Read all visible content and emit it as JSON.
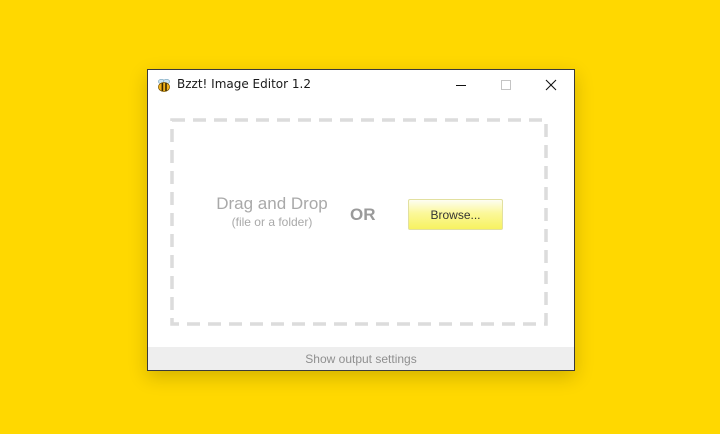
{
  "window": {
    "title": "Bzzt! Image Editor 1.2",
    "app_icon": "bee-icon",
    "controls": {
      "minimize": "minimize-icon",
      "maximize": "maximize-icon",
      "close": "close-icon"
    }
  },
  "dropzone": {
    "title": "Drag and Drop",
    "subtitle": "(file or a folder)",
    "or_label": "OR",
    "browse_label": "Browse..."
  },
  "footer": {
    "label": "Show output settings"
  },
  "colors": {
    "desktop_background": "#FFD800",
    "browse_button_yellow": "#FBF89A",
    "dashed_border": "#DCDCDC",
    "footer_background": "#EEEEEE"
  }
}
